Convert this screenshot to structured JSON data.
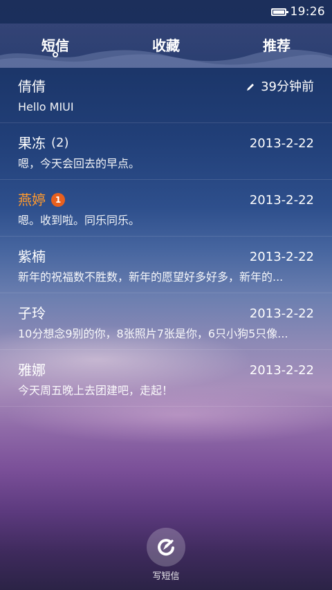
{
  "status_bar": {
    "time": "19:26",
    "battery_icon": "battery-full-icon"
  },
  "tabs": [
    {
      "label": "短信",
      "selected": true
    },
    {
      "label": "收藏",
      "selected": false
    },
    {
      "label": "推荐",
      "selected": false
    }
  ],
  "conversations": [
    {
      "name": "倩倩",
      "count": "",
      "badge": "",
      "time": "39分钟前",
      "draft_icon": "pencil-icon",
      "preview": "Hello MIUI"
    },
    {
      "name": "果冻",
      "count": "(2)",
      "badge": "",
      "time": "2013-2-22",
      "preview": "嗯，今天会回去的早点。"
    },
    {
      "name": "燕婷",
      "count": "",
      "badge": "1",
      "time": "2013-2-22",
      "preview": "嗯。收到啦。同乐同乐。"
    },
    {
      "name": "紫楠",
      "count": "",
      "badge": "",
      "time": "2013-2-22",
      "preview": "新年的祝福数不胜数，新年的愿望好多好多，新年的..."
    },
    {
      "name": "子玲",
      "count": "",
      "badge": "",
      "time": "2013-2-22",
      "preview": "10分想念9别的你，8张照片7张是你，6只小狗5只像..."
    },
    {
      "name": "雅娜",
      "count": "",
      "badge": "",
      "time": "2013-2-22",
      "preview": "今天周五晚上去团建吧，走起！"
    }
  ],
  "compose": {
    "label": "写短信",
    "icon": "compose-icon"
  },
  "colors": {
    "unread_name": "#ff9a2e",
    "badge": "#e8601e"
  }
}
